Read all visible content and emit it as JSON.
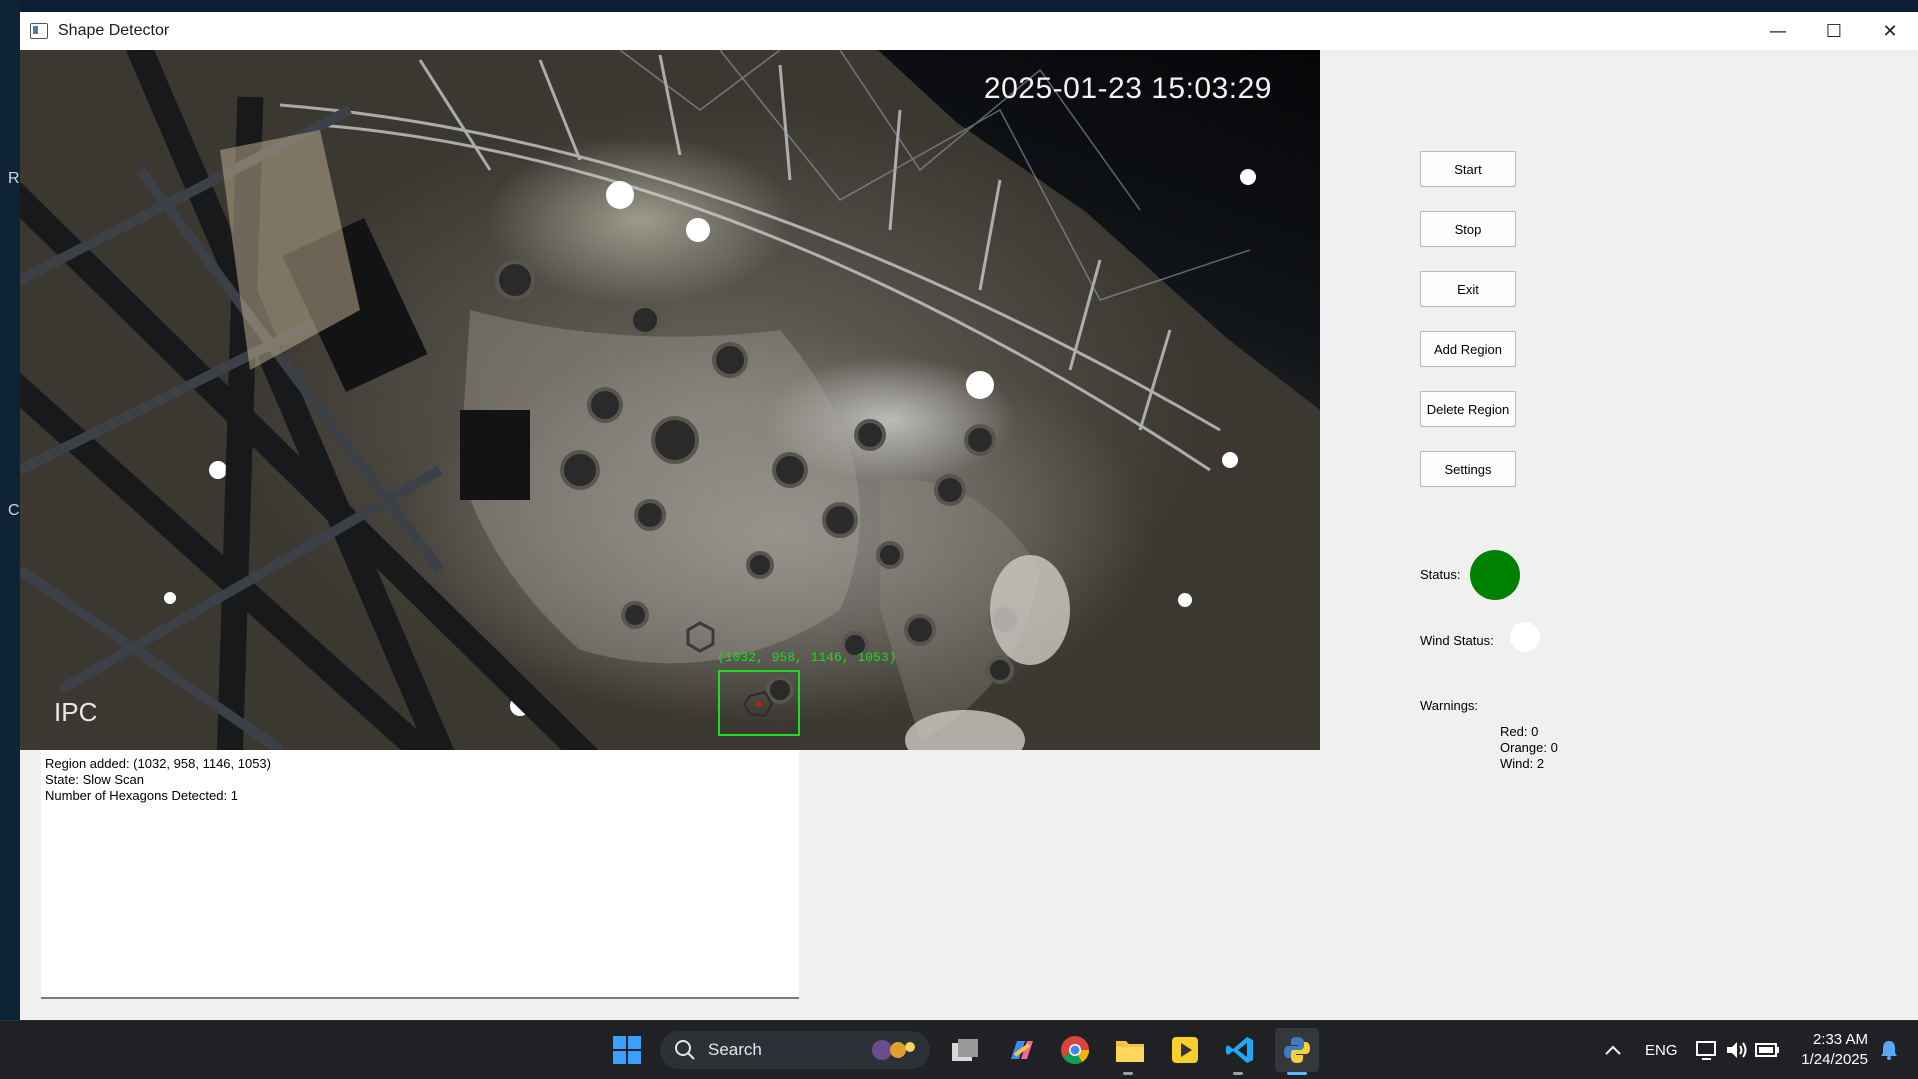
{
  "desktop": {
    "edge_letters": [
      "R",
      "Ca"
    ]
  },
  "window": {
    "title": "Shape Detector",
    "controls": {
      "minimize": "—",
      "maximize": "☐",
      "close": "✕"
    }
  },
  "camera": {
    "timestamp": "2025-01-23 15:03:29",
    "brand": "IPC",
    "detection_label": "(1032, 958, 1146, 1053)"
  },
  "log": {
    "lines": [
      "Region added: (1032, 958, 1146, 1053)",
      "State: Slow Scan",
      "Number of Hexagons Detected: 1"
    ]
  },
  "controls": {
    "start": "Start",
    "stop": "Stop",
    "exit": "Exit",
    "add_region": "Add Region",
    "delete_region": "Delete Region",
    "settings": "Settings"
  },
  "status": {
    "status_label": "Status:",
    "status_color": "#008000",
    "wind_label": "Wind Status:",
    "wind_color": "#ffffff"
  },
  "warnings": {
    "title": "Warnings:",
    "red": "Red: 0",
    "orange": "Orange: 0",
    "wind": "Wind: 2"
  },
  "taskbar": {
    "search_label": "Search",
    "apps": [
      "start-icon",
      "search-icon",
      "task-view-icon",
      "copilot-icon",
      "chrome-icon",
      "file-explorer-icon",
      "media-player-icon",
      "vscode-icon",
      "python-icon"
    ],
    "tray": {
      "language": "ENG",
      "time": "2:33 AM",
      "date": "1/24/2025"
    }
  }
}
